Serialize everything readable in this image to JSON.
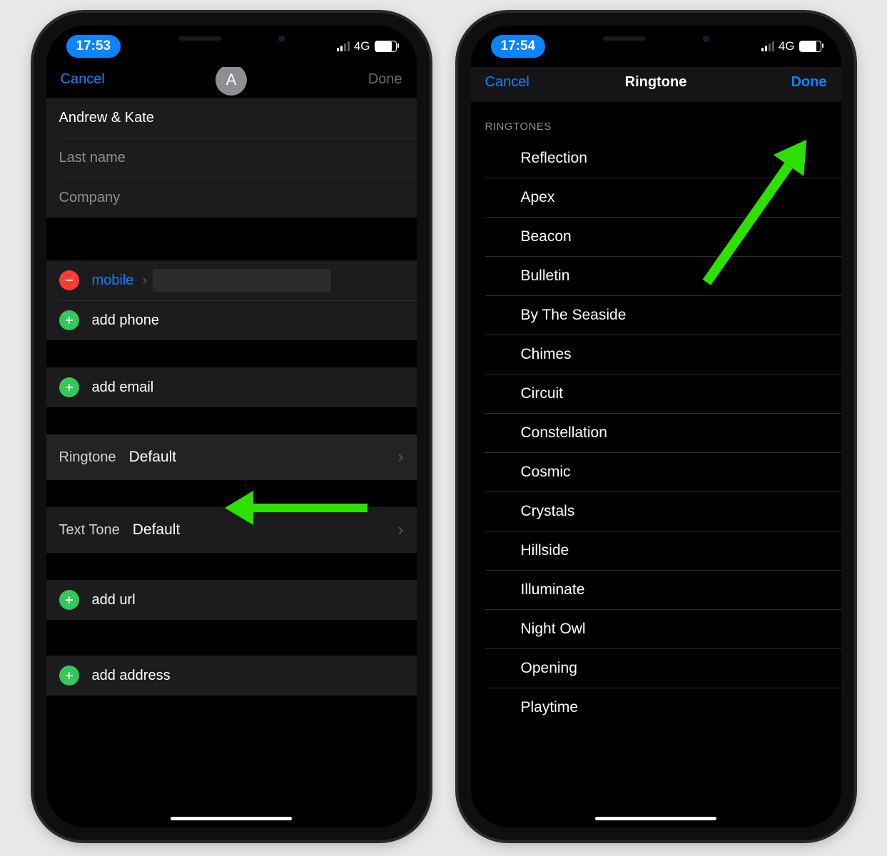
{
  "phone1": {
    "status": {
      "time": "17:53",
      "network": "4G"
    },
    "nav": {
      "cancel": "Cancel",
      "done": "Done",
      "avatar_letter": "A"
    },
    "fields": {
      "first_name": "Andrew & Kate",
      "last_name_placeholder": "Last name",
      "company_placeholder": "Company"
    },
    "phone": {
      "type_label": "mobile",
      "add_phone": "add phone"
    },
    "add_email": "add email",
    "ringtone": {
      "label": "Ringtone",
      "value": "Default"
    },
    "texttone": {
      "label": "Text Tone",
      "value": "Default"
    },
    "add_url": "add url",
    "add_address": "add address"
  },
  "phone2": {
    "status": {
      "time": "17:54",
      "network": "4G"
    },
    "nav": {
      "cancel": "Cancel",
      "title": "Ringtone",
      "done": "Done"
    },
    "section_header": "RINGTONES",
    "ringtones": [
      "Reflection",
      "Apex",
      "Beacon",
      "Bulletin",
      "By The Seaside",
      "Chimes",
      "Circuit",
      "Constellation",
      "Cosmic",
      "Crystals",
      "Hillside",
      "Illuminate",
      "Night Owl",
      "Opening",
      "Playtime"
    ]
  }
}
